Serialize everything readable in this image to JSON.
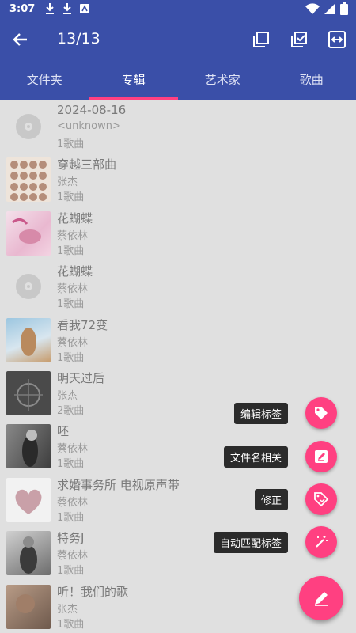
{
  "status_bar": {
    "time": "3:07",
    "icons": [
      "download-icon",
      "download-icon",
      "notification-icon"
    ],
    "right_icons": [
      "wifi-icon",
      "signal-icon",
      "battery-icon"
    ]
  },
  "app_bar": {
    "title": "13/13",
    "actions": [
      "select-copy-icon",
      "select-check-icon",
      "swap-icon"
    ]
  },
  "tabs": [
    {
      "label": "文件夹",
      "active": false
    },
    {
      "label": "专辑",
      "active": true
    },
    {
      "label": "艺术家",
      "active": false
    },
    {
      "label": "歌曲",
      "active": false
    }
  ],
  "albums": [
    {
      "title": "2024-08-16",
      "artist": "<unknown>",
      "count": "1歌曲",
      "art": "disc-placeholder"
    },
    {
      "title": "穿越三部曲",
      "artist": "张杰",
      "count": "1歌曲",
      "art": "grid-faces"
    },
    {
      "title": "花蝴蝶",
      "artist": "蔡依林",
      "count": "1歌曲",
      "art": "pink-cover"
    },
    {
      "title": "花蝴蝶",
      "artist": "蔡依林",
      "count": "1歌曲",
      "art": "disc-placeholder"
    },
    {
      "title": "看我72变",
      "artist": "蔡依林",
      "count": "1歌曲",
      "art": "blue-cover"
    },
    {
      "title": "明天过后",
      "artist": "张杰",
      "count": "2歌曲",
      "art": "dark-cover"
    },
    {
      "title": "呸",
      "artist": "蔡依林",
      "count": "1歌曲",
      "art": "bw-cover"
    },
    {
      "title": "求婚事务所 电视原声带",
      "artist": "蔡依林",
      "count": "1歌曲",
      "art": "heart-cover"
    },
    {
      "title": "特务J",
      "artist": "蔡依林",
      "count": "1歌曲",
      "art": "gray-cover"
    },
    {
      "title": "听！我们的歌",
      "artist": "张杰",
      "count": "1歌曲",
      "art": "tan-cover"
    }
  ],
  "fab_menu": [
    {
      "label": "编辑标签",
      "icon": "tag-icon"
    },
    {
      "label": "文件名相关",
      "icon": "edit-file-icon"
    },
    {
      "label": "修正",
      "icon": "tag-fix-icon"
    },
    {
      "label": "自动匹配标签",
      "icon": "magic-wand-icon"
    }
  ],
  "main_fab": {
    "icon": "pen-icon"
  },
  "colors": {
    "primary": "#3a4fa8",
    "accent": "#ff4081",
    "background": "#e0e0e0"
  }
}
